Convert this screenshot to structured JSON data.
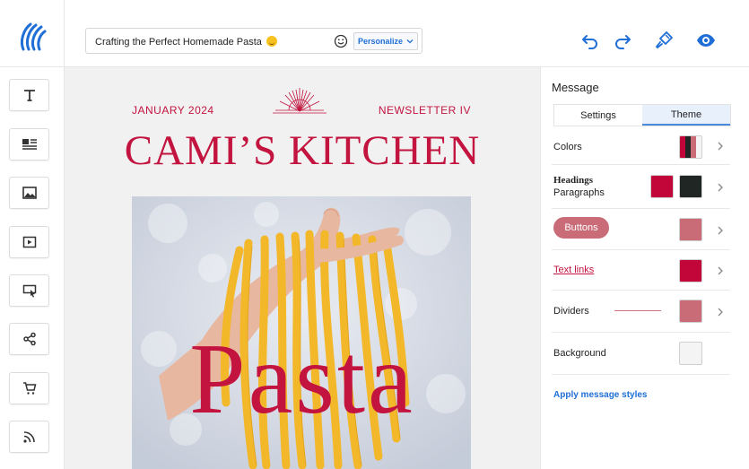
{
  "topbar": {
    "subject": "Crafting the Perfect Homemade Pasta",
    "personalize_label": "Personalize"
  },
  "rail": {
    "tools": [
      "text-tool",
      "text-image-tool",
      "image-tool",
      "video-tool",
      "button-tool",
      "social-share-tool",
      "product-tool",
      "rss-tool"
    ]
  },
  "canvas": {
    "date": "JANUARY 2024",
    "issue": "NEWSLETTER IV",
    "brand": "CAMI’S KITCHEN",
    "hero_word": "Pasta"
  },
  "panel": {
    "title": "Message",
    "tabs": [
      {
        "label": "Settings",
        "active": false
      },
      {
        "label": "Theme",
        "active": true
      }
    ],
    "colors_label": "Colors",
    "headings_label": "Headings",
    "paragraphs_label": "Paragraphs",
    "buttons_label": "Buttons",
    "text_links_label": "Text links",
    "dividers_label": "Dividers",
    "background_label": "Background",
    "apply_label": "Apply message styles"
  },
  "colors": {
    "accent": "#c2143f",
    "heading_color": "#c2063a",
    "paragraph_color": "#1f2623",
    "button_color": "#c96c78",
    "link_color": "#c2063a",
    "divider_color": "#c96c78",
    "background_color": "#f4f4f4",
    "ui_blue": "#1f6fd6"
  }
}
